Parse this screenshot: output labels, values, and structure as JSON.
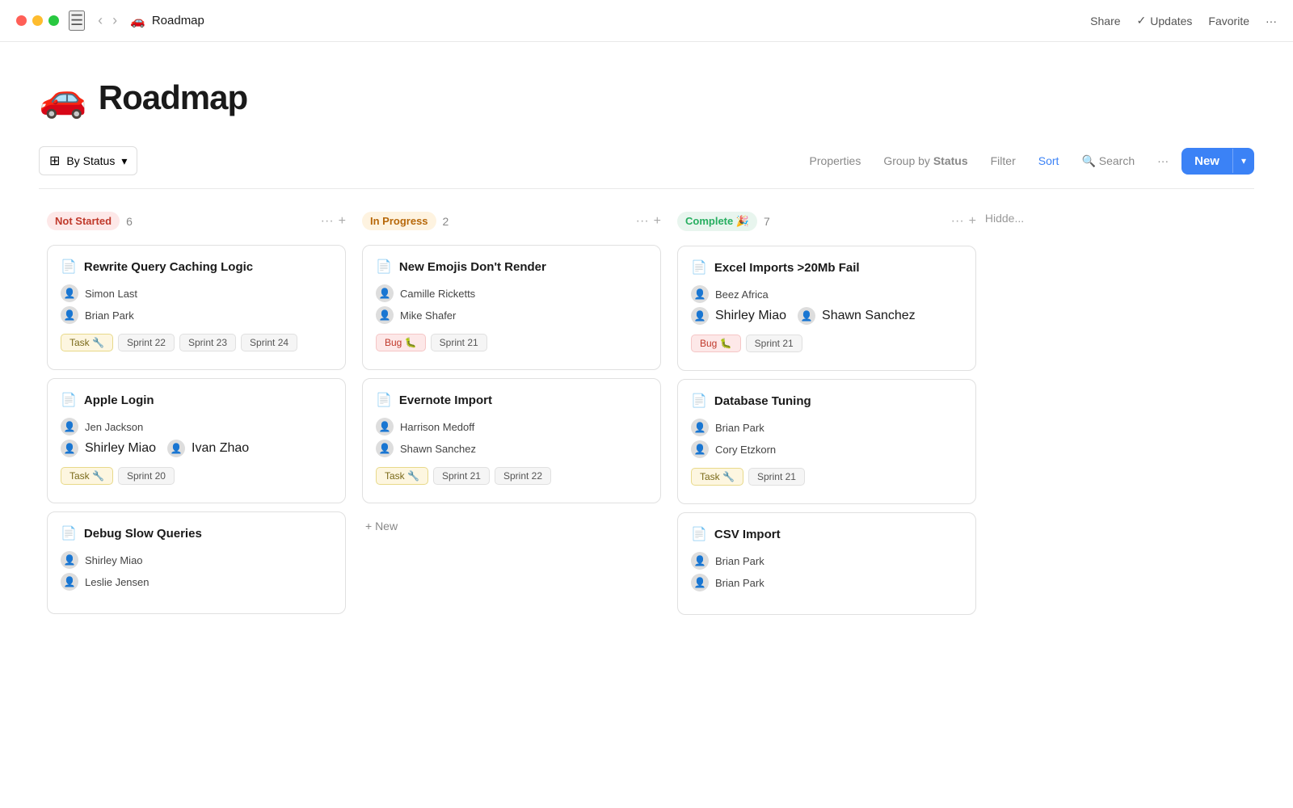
{
  "titlebar": {
    "page_emoji": "🚗",
    "page_title": "Roadmap",
    "share_label": "Share",
    "updates_label": "Updates",
    "favorite_label": "Favorite",
    "more_label": "···"
  },
  "toolbar": {
    "by_status_label": "By Status",
    "properties_label": "Properties",
    "group_by_prefix": "Group by",
    "group_by_value": "Status",
    "filter_label": "Filter",
    "sort_label": "Sort",
    "search_label": "Search",
    "more_label": "···",
    "new_label": "New"
  },
  "page_header": {
    "emoji": "🚗",
    "title": "Roadmap"
  },
  "columns": [
    {
      "id": "not-started",
      "status": "Not Started",
      "status_class": "status-not-started",
      "count": 6,
      "cards": [
        {
          "title": "Rewrite Query Caching Logic",
          "assignees": [
            "Simon Last",
            "Brian Park"
          ],
          "tag_type": "Task 🔧",
          "tag_class": "tag-task",
          "sprints": [
            "Sprint 22",
            "Sprint 23",
            "Sprint 24"
          ]
        },
        {
          "title": "Apple Login",
          "assignees": [
            "Jen Jackson",
            "Shirley Miao",
            "Ivan Zhao"
          ],
          "tag_type": "Task 🔧",
          "tag_class": "tag-task",
          "sprints": [
            "Sprint 20"
          ]
        },
        {
          "title": "Debug Slow Queries",
          "assignees": [
            "Shirley Miao",
            "Leslie Jensen"
          ],
          "tag_type": null,
          "tag_class": null,
          "sprints": []
        }
      ]
    },
    {
      "id": "in-progress",
      "status": "In Progress",
      "status_class": "status-in-progress",
      "count": 2,
      "cards": [
        {
          "title": "New Emojis Don't Render",
          "assignees": [
            "Camille Ricketts",
            "Mike Shafer"
          ],
          "tag_type": "Bug 🐛",
          "tag_class": "tag-bug",
          "sprints": [
            "Sprint 21"
          ]
        },
        {
          "title": "Evernote Import",
          "assignees": [
            "Harrison Medoff",
            "Shawn Sanchez"
          ],
          "tag_type": "Task 🔧",
          "tag_class": "tag-task",
          "sprints": [
            "Sprint 21",
            "Sprint 22"
          ]
        }
      ],
      "new_item_label": "+ New"
    },
    {
      "id": "complete",
      "status": "Complete 🎉",
      "status_class": "status-complete",
      "count": 7,
      "cards": [
        {
          "title": "Excel Imports >20Mb Fail",
          "assignees": [
            "Beez Africa",
            "Shirley Miao",
            "Shawn Sanchez"
          ],
          "tag_type": "Bug 🐛",
          "tag_class": "tag-bug",
          "sprints": [
            "Sprint 21"
          ]
        },
        {
          "title": "Database Tuning",
          "assignees": [
            "Brian Park",
            "Cory Etzkorn"
          ],
          "tag_type": "Task 🔧",
          "tag_class": "tag-task",
          "sprints": [
            "Sprint 21"
          ]
        },
        {
          "title": "CSV Import",
          "assignees": [
            "Brian Park",
            "Brian Park"
          ],
          "tag_type": null,
          "tag_class": null,
          "sprints": []
        }
      ]
    }
  ],
  "hidden_column": {
    "label": "Hidde..."
  }
}
